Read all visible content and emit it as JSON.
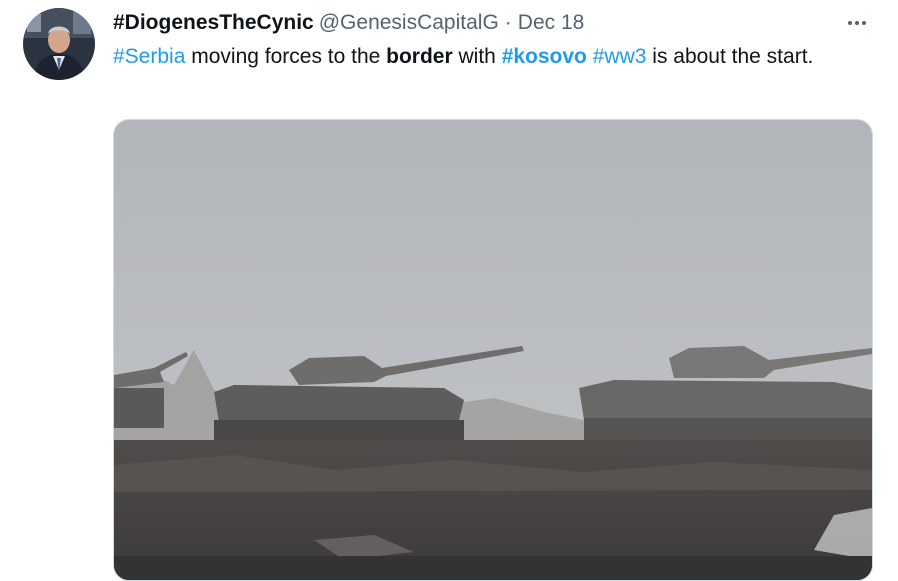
{
  "tweet": {
    "author": {
      "name": "#DiogenesTheCynic",
      "handle": "@GenesisCapitalG"
    },
    "separator": "·",
    "date": "Dec 18",
    "text": {
      "t1": "#Serbia",
      "t2": " moving forces to the ",
      "t3": "border",
      "t4": " with ",
      "t5": "#kosovo",
      "t6": " ",
      "t7": "#ww3",
      "t8": " is about the start."
    },
    "colors": {
      "link": "#1d9bf0",
      "text": "#0f1419",
      "secondary": "#536471"
    },
    "icons": {
      "more": "more-horizontal-icon"
    }
  }
}
